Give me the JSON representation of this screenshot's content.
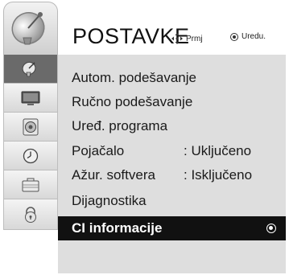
{
  "header": {
    "title": "POSTAVKE",
    "hint_move_icon": "four-way-arrows-icon",
    "hint_move_label": "Prmj",
    "hint_ok_icon": "ok-button-icon",
    "hint_ok_label": "Uredu."
  },
  "sidebar": {
    "header_icon": "satellite-dish-icon",
    "items": [
      {
        "icon": "satellite-dish-icon",
        "active": true
      },
      {
        "icon": "tv-screen-icon",
        "active": false
      },
      {
        "icon": "speaker-icon",
        "active": false
      },
      {
        "icon": "clock-icon",
        "active": false
      },
      {
        "icon": "suitcase-icon",
        "active": false
      },
      {
        "icon": "padlock-icon",
        "active": false
      }
    ]
  },
  "menu": {
    "items": [
      {
        "label": "Autom. podešavanje",
        "value": ""
      },
      {
        "label": "Ručno podešavanje",
        "value": ""
      },
      {
        "label": "Uređ. programa",
        "value": ""
      },
      {
        "label": "Pojačalo",
        "value": ": Uključeno"
      },
      {
        "label": "Ažur. softvera",
        "value": ": Isključeno"
      },
      {
        "label": "Dijagnostika",
        "value": ""
      },
      {
        "label": "CI informacije",
        "value": "",
        "selected": true
      }
    ]
  },
  "colors": {
    "panel_bg": "#dedede",
    "selected_bg": "#111111",
    "active_icon_bg": "#6a6a6a"
  }
}
